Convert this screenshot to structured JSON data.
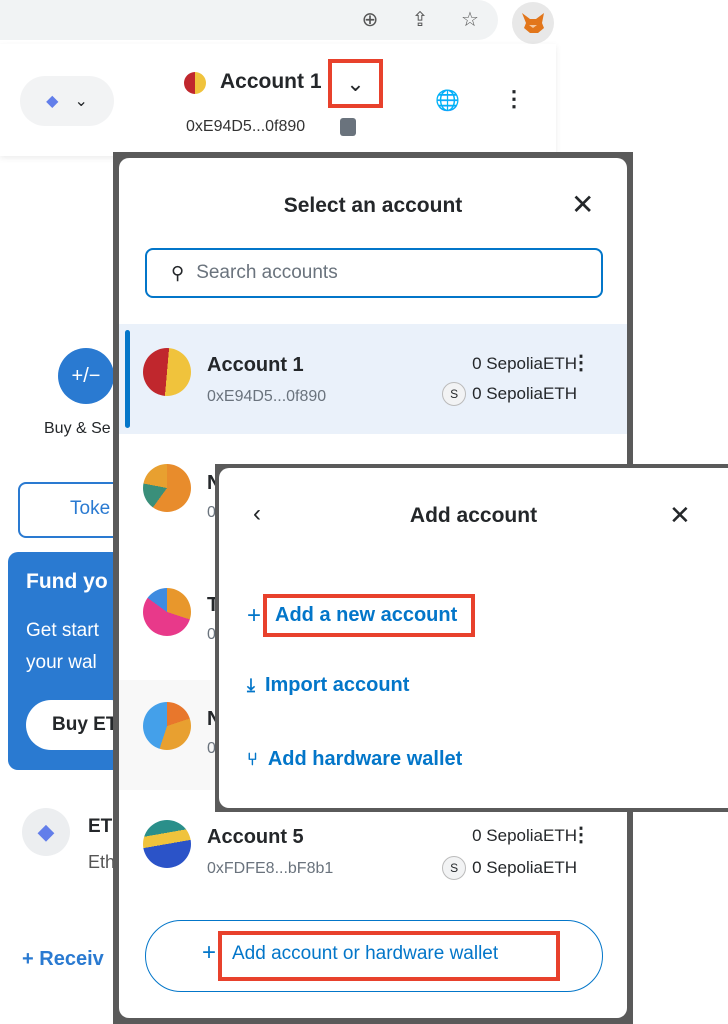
{
  "browser": {
    "icons": [
      "zoom-in-icon",
      "share-icon",
      "star-icon",
      "metamask-fox-icon"
    ]
  },
  "header": {
    "account_name": "Account 1",
    "address": "0xE94D5...0f890",
    "network_icon": "ethereum-icon"
  },
  "background": {
    "buy_sell_label": "Buy & Se",
    "tokens_tab": "Toke",
    "fund_title": "Fund yo",
    "fund_text_1": "Get start",
    "fund_text_2": "your wal",
    "buy_button": "Buy ET",
    "asset_symbol": "ET",
    "asset_name": "Eth",
    "receive_label": "Receiv"
  },
  "select_modal": {
    "title": "Select an account",
    "search_placeholder": "Search accounts",
    "accounts": [
      {
        "name": "Account 1",
        "address": "0xE94D5...0f890",
        "balance": "0 SepoliaETH",
        "sub_balance": "0 SepoliaETH",
        "selected": true
      },
      {
        "name": "N",
        "address": "0"
      },
      {
        "name": "T",
        "address": "0"
      },
      {
        "name": "N",
        "address": "0"
      },
      {
        "name": "Account 5",
        "address": "0xFDFE8...bF8b1",
        "balance": "0 SepoliaETH",
        "sub_balance": "0 SepoliaETH"
      }
    ],
    "add_button": "Add account or hardware wallet"
  },
  "add_modal": {
    "title": "Add account",
    "options": [
      "Add a new account",
      "Import account",
      "Add hardware wallet"
    ]
  },
  "colors": {
    "accent": "#0376c9",
    "highlight": "#e8412c",
    "fund_bg": "#2a7ad1",
    "selected_bg": "#eaf1fa"
  }
}
